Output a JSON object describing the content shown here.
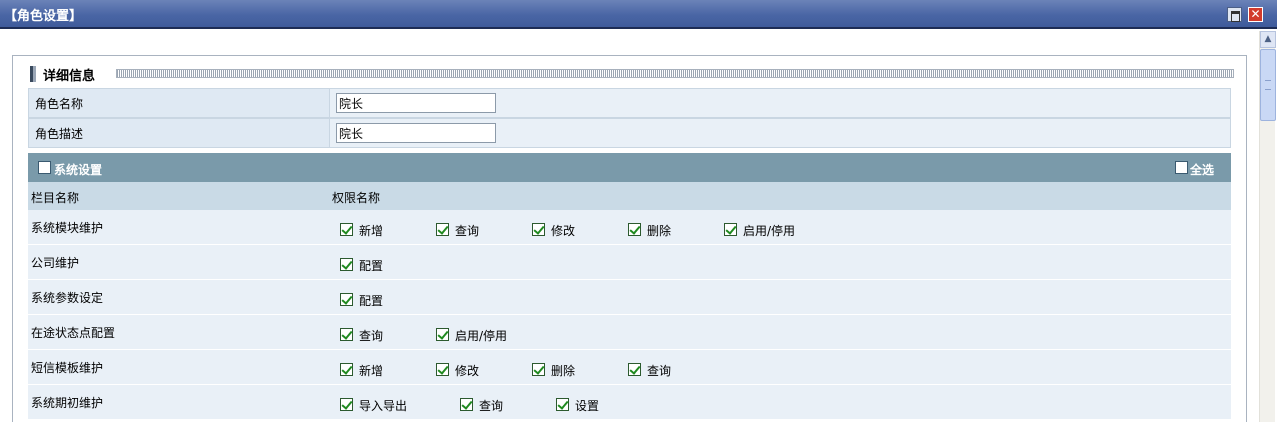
{
  "window": {
    "title": "【角色设置】"
  },
  "section": {
    "title": "详细信息"
  },
  "form": {
    "role_name_label": "角色名称",
    "role_name_value": "院长",
    "role_desc_label": "角色描述",
    "role_desc_value": "院长"
  },
  "group": {
    "name": "系统设置",
    "select_all_label": "全选",
    "col_module": "栏目名称",
    "col_permission": "权限名称"
  },
  "rows": [
    {
      "name": "系统模块维护",
      "perms": [
        "新增",
        "查询",
        "修改",
        "删除",
        "启用/停用"
      ]
    },
    {
      "name": "公司维护",
      "perms": [
        "配置"
      ]
    },
    {
      "name": "系统参数设定",
      "perms": [
        "配置"
      ]
    },
    {
      "name": "在途状态点配置",
      "perms": [
        "查询",
        "启用/停用"
      ]
    },
    {
      "name": "短信模板维护",
      "perms": [
        "新增",
        "修改",
        "删除",
        "查询"
      ]
    },
    {
      "name": "系统期初维护",
      "perms": [
        "导入导出",
        "查询",
        "设置"
      ]
    }
  ]
}
